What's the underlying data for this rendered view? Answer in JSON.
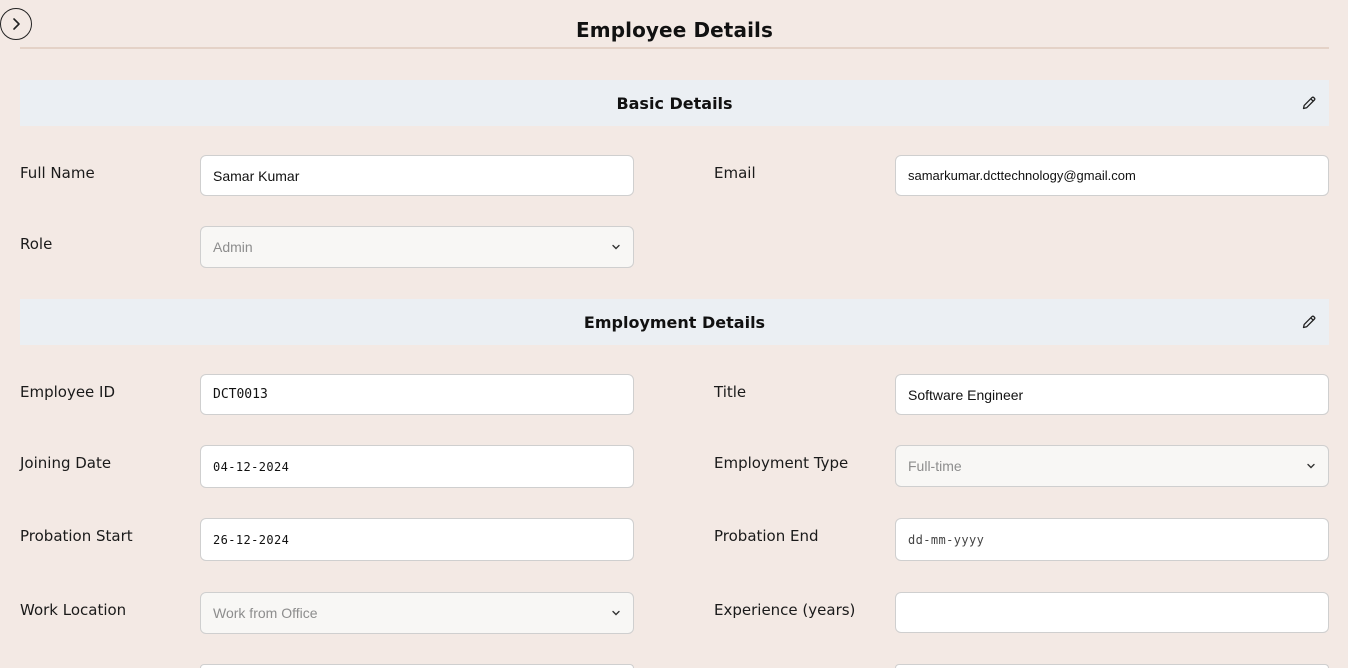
{
  "title": "Employee Details",
  "basic": {
    "header": "Basic Details",
    "full_name_label": "Full Name",
    "full_name_value": "Samar Kumar",
    "email_label": "Email",
    "email_value": "samarkumar.dcttechnology@gmail.com",
    "role_label": "Role",
    "role_value": "Admin"
  },
  "employment": {
    "header": "Employment Details",
    "employee_id_label": "Employee ID",
    "employee_id_value": "DCT0013",
    "title_label": "Title",
    "title_value": "Software Engineer",
    "joining_date_label": "Joining Date",
    "joining_date_value": "04-12-2024",
    "employment_type_label": "Employment Type",
    "employment_type_value": "Full-time",
    "probation_start_label": "Probation Start",
    "probation_start_value": "26-12-2024",
    "probation_end_label": "Probation End",
    "probation_end_placeholder": "dd-mm-yyyy",
    "work_location_label": "Work Location",
    "work_location_value": "Work from Office",
    "experience_label": "Experience (years)",
    "experience_value": ""
  },
  "icons": {
    "toggle": "chevron-right-icon",
    "edit": "pencil-icon"
  }
}
